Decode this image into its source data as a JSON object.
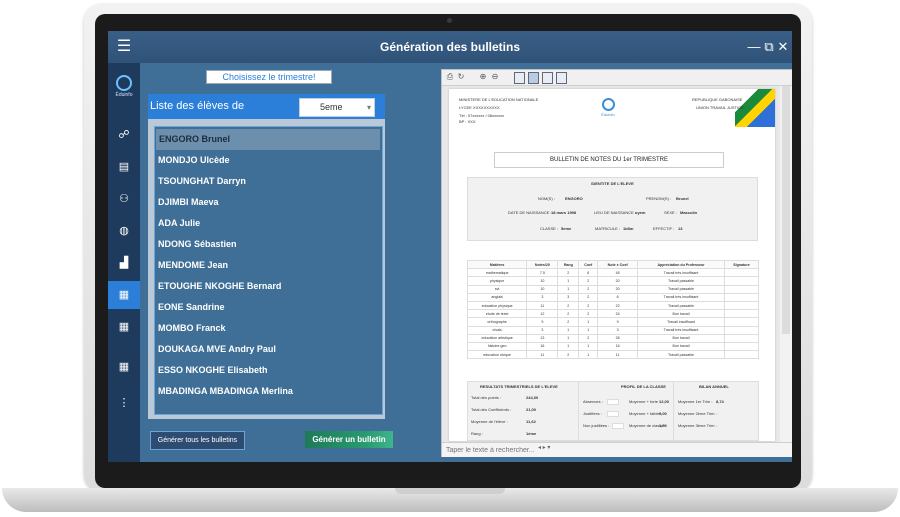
{
  "window": {
    "title": "Génération des bulletins",
    "controls": {
      "minimize": "—",
      "restore": "⧉",
      "close": "✕"
    }
  },
  "sidebar": {
    "menu_icon": "☰",
    "logo_text": "Éduinfo",
    "items": [
      {
        "name": "users-icon",
        "glyph": "☍"
      },
      {
        "name": "book-icon",
        "glyph": "▤"
      },
      {
        "name": "group-icon",
        "glyph": "⚇"
      },
      {
        "name": "subject-icon",
        "glyph": "◍"
      },
      {
        "name": "chart-icon",
        "glyph": "▟"
      },
      {
        "name": "report-icon",
        "glyph": "▦",
        "active": true
      },
      {
        "name": "document-icon",
        "glyph": "▦"
      },
      {
        "name": "file-icon",
        "glyph": "▦"
      },
      {
        "name": "more-icon",
        "glyph": "⋮"
      }
    ]
  },
  "trimester_button": "Choisissez le trimestre!",
  "list": {
    "label": "Liste des élèves de",
    "class_selected": "5eme",
    "students": [
      "ENGORO Brunel",
      "MONDJO Ulcède",
      "TSOUNGHAT Darryn",
      "DJIMBI Maeva",
      "ADA Julie",
      "NDONG Sébastien",
      "MENDOME Jean",
      "ETOUGHE NKOGHE Bernard",
      "EONE Sandrine",
      "MOMBO  Franck",
      "DOUKAGA MVE Andry Paul",
      "ESSO NKOGHE Elisabeth",
      "MBADINGA MBADINGA Merlina"
    ]
  },
  "buttons": {
    "generate_all": "Générer tous les bulletins",
    "generate_one": "Générer un bulletin"
  },
  "viewer": {
    "search_placeholder": "Taper le texte à rechercher...",
    "search_nav": "◂ ▸ ▾",
    "bulletin": {
      "ministry": "MINISTERE DE L'EDUCATION NATIONALE",
      "school_code": "LYCEE XXXXXXXXXX",
      "tel": "Tél : 07xxxxxx / 06xxxxxx",
      "bp": "BP : XXX",
      "logo_text": "Éduinfo",
      "republic": "REPUBLIQUE GABONAISE",
      "motto": "UNION TRAVAIL JUSTICE",
      "title": "BULLETIN DE NOTES DU 1er TRIMESTRE",
      "identity_header": "IDENTITE DE L'ELEVE",
      "nom_label": "NOM(S) :",
      "nom": "ENGORO",
      "prenom_label": "PRENOM(S) :",
      "prenom": "Brunel",
      "dob_label": "DATE DE NAISSANCE :",
      "dob": "18 mars 1998",
      "pob_label": "LIEU DE NAISSANCE :",
      "pob": "oyem",
      "sexe_label": "SEXE :",
      "sexe": "Masculin",
      "classe_label": "CLASSE :",
      "classe": "5eme",
      "matricule_label": "MATRICULE :",
      "matricule": "1b5m",
      "effectif_label": "EFFECTIF :",
      "effectif": "13",
      "table_headers": [
        "Matières",
        "Notes/20",
        "Rang",
        "Coef",
        "Note x Coef",
        "Appréciation du Professeur",
        "Signature"
      ],
      "rows": [
        [
          "mathematique",
          "7.5",
          "2",
          "6",
          "45",
          "Travail très insuffisant",
          ""
        ],
        [
          "physique",
          "10",
          "1",
          "2",
          "20",
          "Travail passable",
          ""
        ],
        [
          "svt",
          "10",
          "1",
          "2",
          "20",
          "Travail passable",
          ""
        ],
        [
          "anglais",
          "3",
          "3",
          "2",
          "6",
          "Travail très insuffisant",
          ""
        ],
        [
          "education physique",
          "11",
          "2",
          "2",
          "22",
          "Travail passable",
          ""
        ],
        [
          "etude de texte",
          "12",
          "2",
          "2",
          "24",
          "Bon travail",
          ""
        ],
        [
          "orthographe",
          "9",
          "2",
          "1",
          "9",
          "Travail insuffisant",
          ""
        ],
        [
          "ctvals",
          "3",
          "1",
          "1",
          "3",
          "Travail très insuffisant",
          ""
        ],
        [
          "education artistique",
          "13",
          "1",
          "2",
          "26",
          "Bon travail",
          ""
        ],
        [
          "histoire-geo",
          "16",
          "1",
          "1",
          "16",
          "Bon travail",
          ""
        ],
        [
          "education civique",
          "11",
          "2",
          "1",
          "11",
          "Travail passable",
          ""
        ]
      ],
      "summary": {
        "results_header": "RESULTATS TRIMESTRIELS DE L'ELEVE",
        "total_points_label": "Total des points :",
        "total_points": "244,00",
        "total_coef_label": "Total des Coefficients :",
        "total_coef": "21,00",
        "moyenne_label": "Moyenne de l'élève :",
        "moyenne": "11,62",
        "rang_label": "Rang :",
        "rang": "1ème",
        "profile_header": "PROFIL DE LA CLASSE",
        "absences_label": "Absences :",
        "justified_label": "Justifiées :",
        "unjustified_label": "Non justifiées :",
        "moy_forte_label": "Moyenne + forte :",
        "moy_forte": "12,00",
        "moy_faible_label": "Moyenne + faible :",
        "moy_faible": "9,00",
        "moy_classe_label": "Moyenne de classe :",
        "moy_classe": "1,50",
        "annual_header": "BILAN ANNUEL",
        "t1_label": "Moyenne 1er Trim :",
        "t1": "8,74",
        "t2_label": "Moyenne 2ème Trim :",
        "t3_label": "Moyenne 3ème Trim :"
      }
    }
  }
}
